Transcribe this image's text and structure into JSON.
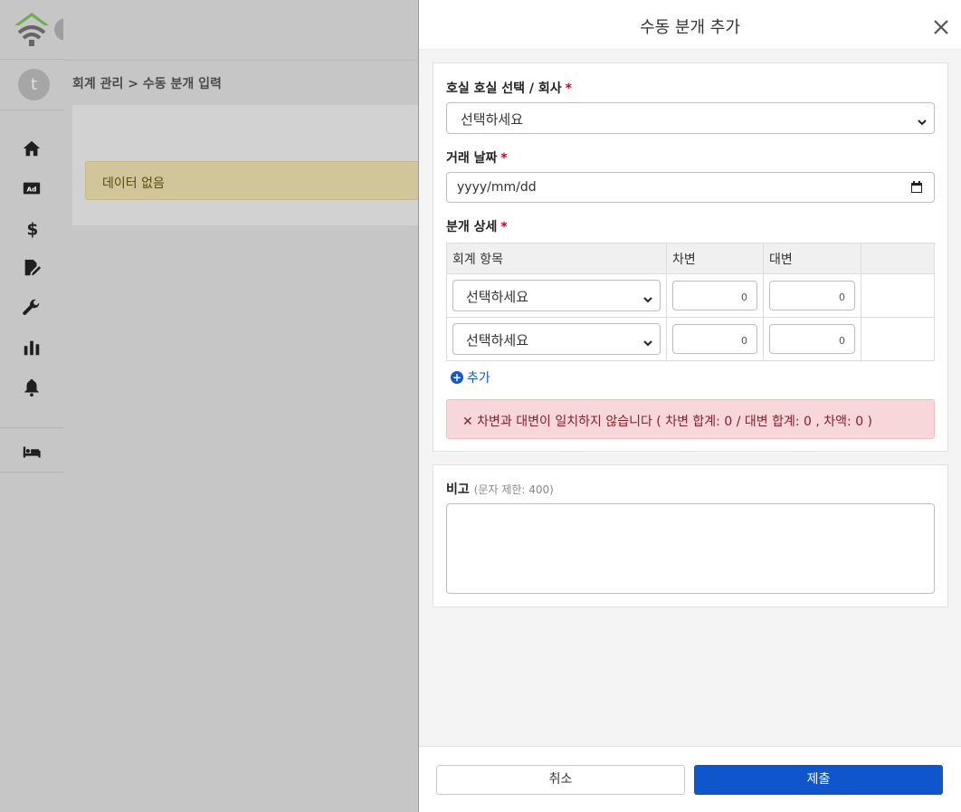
{
  "sidebar": {
    "avatar_letter": "t",
    "nav_icons": [
      "home-icon",
      "ad-icon",
      "dollar-icon",
      "document-edit-icon",
      "wrench-icon",
      "bar-chart-icon",
      "bell-icon",
      "bed-icon"
    ],
    "logo_color": "#6ab04c"
  },
  "breadcrumb": "회계 관리 > 수동 분개 입력",
  "main": {
    "empty_message": "데이터 없음"
  },
  "modal": {
    "title": "수동 분개 추가",
    "room_label": "호실 호실 선택 / 회사",
    "room_select": "선택하세요",
    "date_label": "거래 날짜",
    "date_placeholder": "yyyy/mm/dd",
    "detail_label": "분개 상세",
    "required_mark": "*",
    "table": {
      "headers": [
        "회계 항목",
        "차변",
        "대변",
        ""
      ],
      "rows": [
        {
          "account": "선택하세요",
          "debit": "0",
          "credit": "0"
        },
        {
          "account": "선택하세요",
          "debit": "0",
          "credit": "0"
        }
      ]
    },
    "add_label": "추가",
    "error_message": "✕ 차변과 대변이 일치하지 않습니다 ( 차변 합계: 0 / 대변 합계: 0 , 차액: 0 )",
    "note_label": "비고",
    "note_hint": "(문자 제한: 400)",
    "cancel_label": "취소",
    "submit_label": "제출",
    "accent_color": "#0f55cc",
    "error_color": "#f8d7da"
  }
}
